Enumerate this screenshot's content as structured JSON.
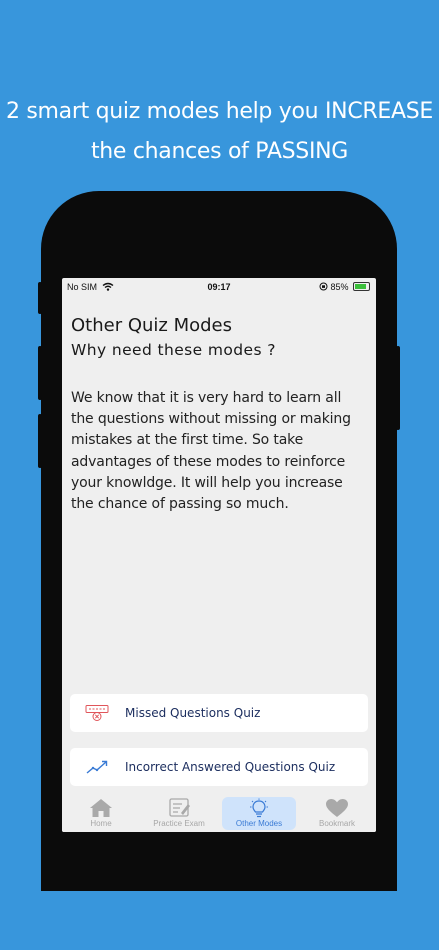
{
  "promo": {
    "line1": "2 smart quiz modes help you INCREASE",
    "line2": "the chances of PASSING"
  },
  "status_bar": {
    "carrier": "No SIM",
    "time": "09:17",
    "battery": "85%"
  },
  "page": {
    "title": "Other Quiz Modes",
    "subtitle": "Why need these modes ?",
    "body": "We know that it is very hard to learn all the questions without missing or making mistakes at the first time. So take advantages of these modes to reinforce your knowldge. It will help you increase the chance of passing so much."
  },
  "modes": [
    {
      "label": "Missed Questions Quiz",
      "icon": "missed-questions-icon"
    },
    {
      "label": "Incorrect Answered Questions Quiz",
      "icon": "incorrect-answers-icon"
    }
  ],
  "tabs": [
    {
      "label": "Home",
      "icon": "home-icon",
      "active": false
    },
    {
      "label": "Practice Exam",
      "icon": "practice-exam-icon",
      "active": false
    },
    {
      "label": "Other Modes",
      "icon": "lightbulb-icon",
      "active": true
    },
    {
      "label": "Bookmark",
      "icon": "heart-icon",
      "active": false
    }
  ],
  "colors": {
    "background": "#3896dc",
    "phone_frame": "#0b0b0b",
    "screen": "#efefef",
    "active_tab": "#cfe3fb",
    "accent": "#3a7bd5",
    "mode_label": "#1b2d5e",
    "missed_icon": "#e0555a"
  }
}
